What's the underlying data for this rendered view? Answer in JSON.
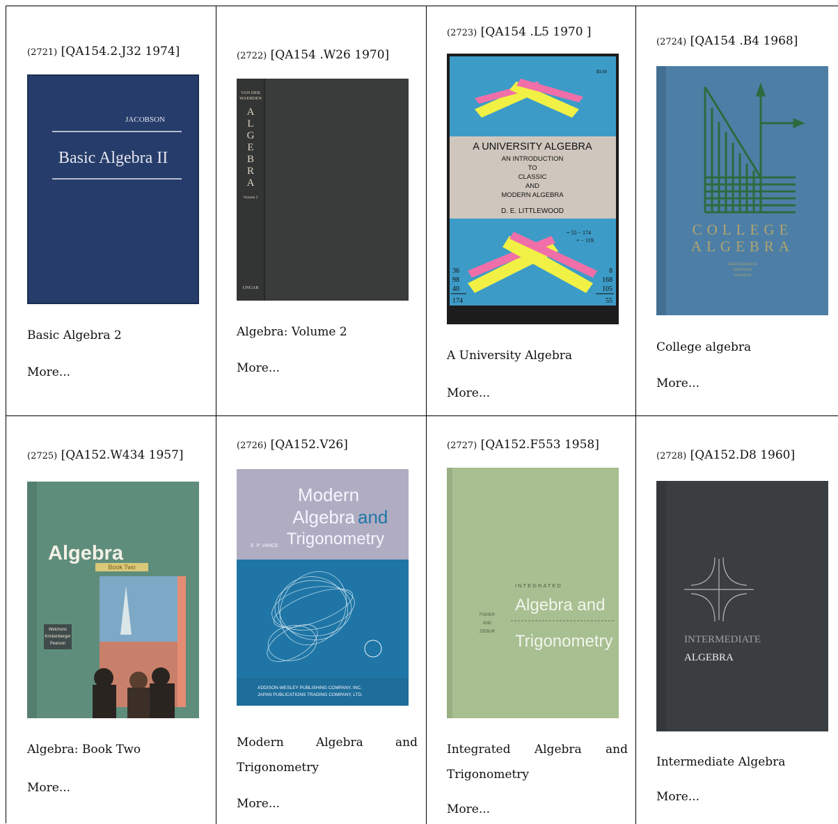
{
  "books": [
    {
      "number": "(2721)",
      "call": "[QA154.2.J32 1974]",
      "title": "Basic Algebra 2",
      "more": "More...",
      "cover": {
        "author": "JACOBSON",
        "title": "Basic Algebra II",
        "color": "#263d6b"
      }
    },
    {
      "number": "(2722)",
      "call": "[QA154 .W26 1970]",
      "title": "Algebra: Volume 2",
      "more": "More...",
      "cover": {
        "spine_author_line1": "VAN DER",
        "spine_author_line2": "WAERDEN",
        "spine_letters": [
          "A",
          "L",
          "G",
          "E",
          "B",
          "R",
          "A"
        ],
        "spine_volume": "Volume 2",
        "spine_publisher": "UNGAR",
        "color": "#3a3b3b"
      }
    },
    {
      "number": "(2723)",
      "call": "[QA154 .L5 1970 ]",
      "title": "A University Algebra",
      "more": "More...",
      "cover": {
        "price": "$3.00",
        "title": "A UNIVERSITY ALGEBRA",
        "sub1": "AN INTRODUCTION",
        "sub2": "TO",
        "sub3": "CLASSIC",
        "sub4": "AND",
        "sub5": "MODERN ALGEBRA",
        "author": "D. E. LITTLEWOOD",
        "eq1": "= 55 − 174",
        "eq2": "= − 119.",
        "left_numbers": [
          "36",
          "98",
          "40",
          "174"
        ],
        "right_numbers": [
          "8",
          "168",
          "105",
          "55"
        ],
        "color": "#3d9bc7"
      }
    },
    {
      "number": "(2724)",
      "call": "[QA154 .B4 1968]",
      "title": "College algebra",
      "more": "More...",
      "cover": {
        "line1": "COLLEGE",
        "line2": "ALGEBRA",
        "authors1": "BEECKENBACH",
        "authors2": "DROOYAN",
        "authors3": "WOOTON",
        "color": "#4d7fa6"
      }
    },
    {
      "number": "(2725)",
      "call": "[QA152.W434 1957]",
      "title": "Algebra: Book Two",
      "more": "More...",
      "cover": {
        "title": "Algebra",
        "subtitle": "Book Two",
        "authors1": "Welchons",
        "authors2": "Krickenberger",
        "authors3": "Pearson",
        "color": "#5f8d7c"
      }
    },
    {
      "number": "(2726)",
      "call": "[QA152.V26]",
      "title": "Modern Algebra and Trigonometry",
      "more": "More...",
      "cover": {
        "title1": "Modern",
        "title2": "Algebra",
        "title2b": "and",
        "title3": "Trigonometry",
        "author": "E. P. VANCE",
        "pub1": "ADDISON-WESLEY PUBLISHING COMPANY, INC.",
        "pub2": "JAPAN PUBLICATIONS TRADING COMPANY, LTD.",
        "color": "#1f76a6"
      }
    },
    {
      "number": "(2727)",
      "call": "[QA152.F553 1958]",
      "title": "Integrated Algebra and Trigonometry",
      "more": "More...",
      "cover": {
        "small": "INTEGRATED",
        "title1": "Algebra and",
        "title2": "Trigonometry",
        "authors1": "FISHER",
        "authors2": "AND",
        "authors3": "ZIEBUR",
        "color": "#a8bf91"
      }
    },
    {
      "number": "(2728)",
      "call": "[QA152.D8 1960]",
      "title": "Intermediate Algebra",
      "more": "More...",
      "cover": {
        "line1": "INTERMEDIATE",
        "line2": "ALGEBRA",
        "color": "#3b3e40"
      }
    }
  ]
}
